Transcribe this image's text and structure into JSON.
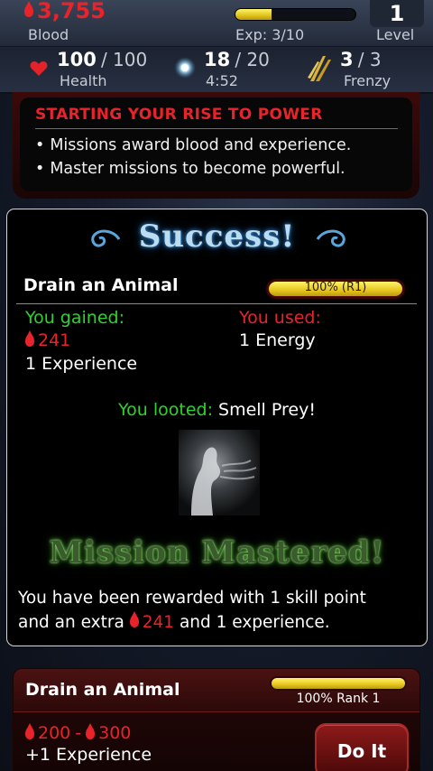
{
  "status": {
    "blood": "3,755",
    "blood_label": "Blood",
    "exp_label": "Exp: 3/10",
    "exp_progress": 0.3,
    "level": "1",
    "level_label": "Level",
    "health": "100",
    "health_sep": "/ 100",
    "health_label": "Health",
    "energy": "18",
    "energy_sep": "/ 20",
    "energy_timer": "4:52",
    "frenzy": "3",
    "frenzy_sep": "/ 3",
    "frenzy_label": "Frenzy"
  },
  "tip": {
    "title": "STARTING YOUR RISE TO POWER",
    "items": [
      "Missions award blood and experience.",
      "Master missions to become powerful."
    ]
  },
  "result": {
    "title": "Success!",
    "mission": "Drain an Animal",
    "mastery": "100% (R1)",
    "gained_label": "You gained:",
    "gained_blood": "241",
    "gained_exp": "1 Experience",
    "used_label": "You used:",
    "used_value": "1 Energy",
    "looted_label": "You looted:",
    "looted_item": "Smell Prey!",
    "mastered_title": "Mission Mastered!",
    "reward_line1": "You have been rewarded with 1 skill point",
    "reward_line2_a": "and an extra",
    "reward_blood": "241",
    "reward_line2_b": "and 1 experience."
  },
  "card": {
    "title": "Drain an Animal",
    "rank": "100% Rank 1",
    "rank_progress": 1.0,
    "blood_min": "200",
    "blood_sep": "-",
    "blood_max": "300",
    "exp": "+1 Experience",
    "button": "Do It"
  },
  "colors": {
    "blood_red": "#e8232a",
    "gain_green": "#2fd12f",
    "bar_gold": "#e7c51e"
  }
}
